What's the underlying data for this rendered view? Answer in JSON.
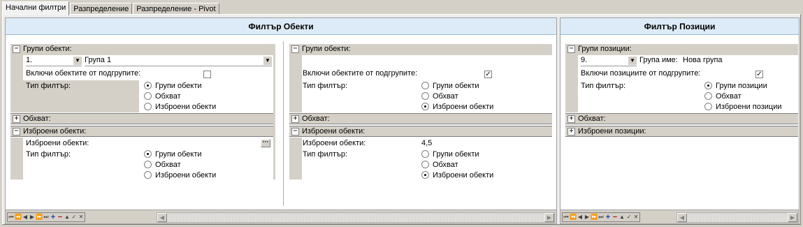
{
  "tabs": [
    {
      "label": "Начални филтри",
      "active": true
    },
    {
      "label": "Разпределение",
      "active": false
    },
    {
      "label": "Разпределение - Pivot",
      "active": false
    }
  ],
  "left_panel": {
    "title": "Филтър Обекти",
    "block1": {
      "groups_header": "Групи обекти:",
      "group_number": "1.",
      "group_name": "Група 1",
      "include_sub_label": "Включи обектите от подгрупите:",
      "include_sub_checked": false,
      "filter_type_label": "Тип филтър:",
      "options": [
        "Групи обекти",
        "Обхват",
        "Изброени обекти"
      ],
      "selected_option": 0,
      "scope_header": "Обхват:",
      "listed_header": "Изброени обекти:",
      "listed_label": "Изброени обекти:",
      "listed_value": "",
      "ellipsis": "···",
      "listed_filter_label": "Тип филтър:",
      "listed_options": [
        "Групи обекти",
        "Обхват",
        "Изброени обекти"
      ],
      "listed_selected": 0
    },
    "block2": {
      "groups_header": "Групи обекти:",
      "include_sub_label": "Включи обектите от подгрупите:",
      "include_sub_checked": true,
      "filter_type_label": "Тип филтър:",
      "options": [
        "Групи обекти",
        "Обхват",
        "Изброени обекти"
      ],
      "selected_option": 2,
      "scope_header": "Обхват:",
      "listed_header": "Изброени обекти:",
      "listed_label": "Изброени обекти:",
      "listed_value": "4,5",
      "listed_filter_label": "Тип филтър:",
      "listed_options": [
        "Групи обекти",
        "Обхват",
        "Изброени обекти"
      ],
      "listed_selected": 2
    }
  },
  "right_panel": {
    "title": "Филтър Позиции",
    "groups_header": "Групи позиции:",
    "group_number": "9.",
    "group_name_label": "Група име:",
    "group_name": "Нова група",
    "include_sub_label": "Включи позициите от подгрупите:",
    "include_sub_checked": true,
    "filter_type_label": "Тип филтър:",
    "options": [
      "Групи позиции",
      "Обхват",
      "Изброени позиции"
    ],
    "selected_option": 0,
    "scope_header": "Обхват:",
    "listed_header": "Изброени позиции:"
  },
  "icons": {
    "check": "✓",
    "dropdown": "▼",
    "expand": "+",
    "collapse": "−",
    "nav_first": "⏮",
    "nav_prev_page": "⏪",
    "nav_prev": "◀",
    "nav_next": "▶",
    "nav_next_page": "⏩",
    "nav_last": "⏭",
    "add": "+",
    "delete": "−",
    "up": "▲",
    "confirm": "✓",
    "cancel": "✕",
    "scroll_left": "◀",
    "scroll_right": "▶"
  }
}
